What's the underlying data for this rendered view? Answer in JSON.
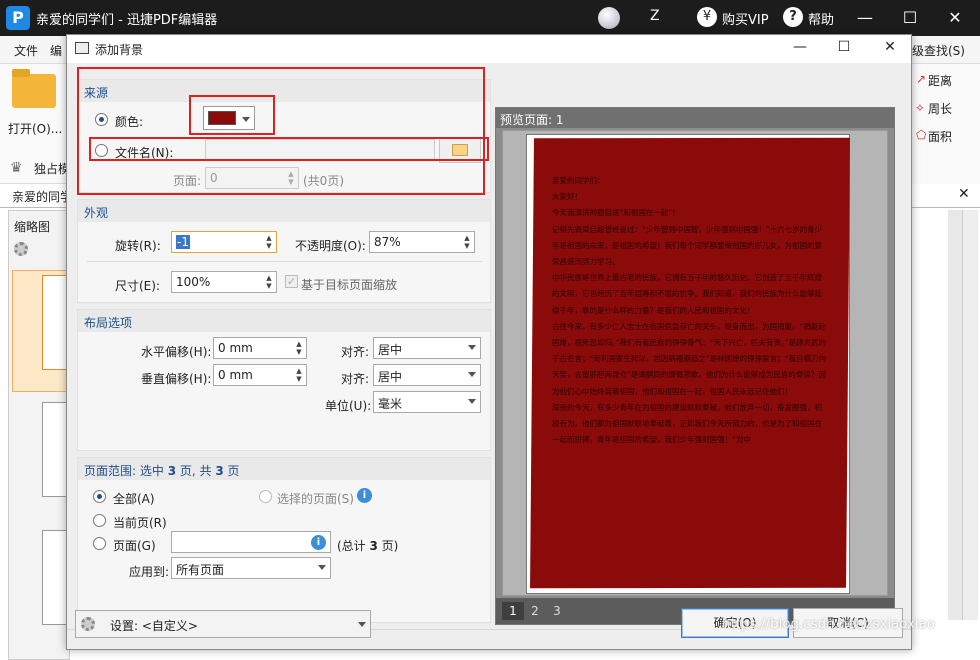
{
  "app": {
    "logo_letter": "P",
    "title": "亲爱的同学们 - 迅捷PDF编辑器",
    "user_initial": "Z",
    "vip_label": "购买VIP",
    "help_label": "帮助",
    "minimize": "—",
    "maximize": "☐",
    "close": "✕"
  },
  "menu": {
    "file": "文件",
    "edit": "编",
    "right_item": "级查找(S)"
  },
  "ribbon": {
    "open_label": "打开(O)...",
    "exclusive_label": "独占模",
    "right_items": [
      "距离",
      "周长",
      "面积"
    ]
  },
  "doc_tab": {
    "label": "亲爱的同学"
  },
  "thumbs_panel": {
    "title": "缩略图"
  },
  "dialog": {
    "title": "添加背景",
    "source": {
      "header": "来源",
      "color_label": "颜色:",
      "color_value": "#8b0a0a",
      "file_label": "文件名(N):",
      "file_value": "",
      "page_label": "页面:",
      "page_value": "0",
      "page_total": "(共0页)"
    },
    "appearance": {
      "header": "外观",
      "rotate_label": "旋转(R):",
      "rotate_value": "-1",
      "opacity_label": "不透明度(O):",
      "opacity_value": "87%",
      "size_label": "尺寸(E):",
      "size_value": "100%",
      "scale_label": "基于目标页面缩放"
    },
    "layout": {
      "header": "布局选项",
      "h_offset_label": "水平偏移(H):",
      "h_offset_value": "0 mm",
      "v_offset_label": "垂直偏移(H):",
      "v_offset_value": "0 mm",
      "align_label_1": "对齐:",
      "align_value_1": "居中",
      "align_label_2": "对齐:",
      "align_value_2": "居中",
      "unit_label": "单位(U):",
      "unit_value": "毫米"
    },
    "page_range": {
      "header_prefix": "页面范围: 选中 ",
      "header_selected": "3",
      "header_mid": " 页, 共 ",
      "header_total": "3",
      "header_suffix": " 页",
      "all_label": "全部(A)",
      "selected_pages_label": "选择的页面(S)",
      "current_label": "当前页(R)",
      "pages_label": "页面(G)",
      "pages_value": "",
      "pages_total_prefix": "(总计 ",
      "pages_total_num": "3",
      "pages_total_suffix": " 页)",
      "apply_label": "应用到:",
      "apply_value": "所有页面"
    },
    "preview": {
      "header": "预览页面: 1",
      "pages": [
        "1",
        "2",
        "3"
      ],
      "doc_text": "亲爱的同学们：\n大家好！\n今天我演讲的题目是“和祖国在一起”！\n记得先贤梁启超曾经说过：“少年智则中国智，少年强则中国强！”十六七岁的青少年是祖国的未来，是祖国的希望！我们每个同学都要做祖国的好儿女，为祖国的繁荣昌盛而努力学习。\n中华民族是世界上最古老的民族，它拥有五千年的悠久历史。它创造了五千年辉煌的文明，它也经历了百年屈辱和不屈的抗争。我们知道，我们的民族为什么能够延续千年，靠的是什么样的力量？是我们的人民和祖国的文化！\n古往今来，有多少仁人志士在祖国危急存亡的关头，挺身而出，为国捐躯。“捐躯赴国难，视死忽如归。”我们有着民族的铮铮骨气：“天下兴亡，匹夫有责。”是顾炎武的千古名言；“苟利国家生死以，岂因祸福避趋之”是林则徐的铮铮誓言；“我自横刀向天笑，去留肝胆两昆仑”是谭嗣同的慷慨悲歌。他们为什么能够成为民族的脊梁？因为他们心中始终装着祖国，他们和祖国在一起，祖国人民永远记住他们！\n深夜的今天，有多少青年在为祖国的建设默默奉献，他们放弃一切，奋发图强，积极有为。他们都为祖国默默地奉献着，正如我们今天所努力的，也是为了和祖国在一起而拼搏，青年是祖国的希望，我们少年强则国强！”为中"
    },
    "settings_label": "设置: <自定义>",
    "ok_label": "确定(O)",
    "cancel_label": "取消(C)"
  },
  "watermark": "https://blog.csdn.net/zsxiaoxiao"
}
